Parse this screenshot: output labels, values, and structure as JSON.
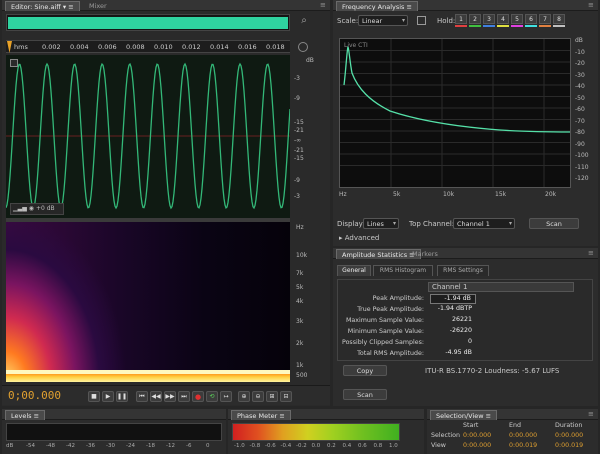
{
  "editor": {
    "tab_label": "Editor: Sine.aiff",
    "mixer_tab": "Mixer",
    "ruler_ticks": [
      "hms",
      "0.002",
      "0.004",
      "0.006",
      "0.008",
      "0.010",
      "0.012",
      "0.014",
      "0.016",
      "0.018"
    ],
    "db_scale": [
      "dB",
      "-3",
      "-9",
      "-15",
      "-21",
      "-∞",
      "-21",
      "-15",
      "-9",
      "-3"
    ],
    "hud_value": "+0 dB",
    "freq_scale": [
      "Hz",
      "10k",
      "7k",
      "5k",
      "4k",
      "3k",
      "2k",
      "1k",
      "500"
    ],
    "time_display": "0;00.000"
  },
  "frequency": {
    "tab_label": "Frequency Analysis",
    "scale_label": "Scale:",
    "scale_value": "Linear",
    "hold_label": "Hold:",
    "hold_buttons": [
      "1",
      "2",
      "3",
      "4",
      "5",
      "6",
      "7",
      "8"
    ],
    "hold_colors": [
      "#e04040",
      "#40c040",
      "#4080e0",
      "#e0e040",
      "#e040e0",
      "#40e0e0",
      "#e08040",
      "#c0c0c0"
    ],
    "live_label": "Live CTI",
    "x_ticks": [
      "Hz",
      "5k",
      "10k",
      "15k",
      "20k"
    ],
    "y_ticks": [
      "dB",
      "-10",
      "-20",
      "-30",
      "-40",
      "-50",
      "-60",
      "-70",
      "-80",
      "-90",
      "-100",
      "-110",
      "-120"
    ],
    "display_label": "Display:",
    "display_value": "Lines",
    "top_channel_label": "Top Channel:",
    "top_channel_value": "Channel 1",
    "scan_label": "Scan",
    "advanced_label": "Advanced"
  },
  "amplitude": {
    "tab_label": "Amplitude Statistics",
    "markers_tab": "Markers",
    "subtabs": [
      "General",
      "RMS Histogram",
      "RMS Settings"
    ],
    "channel_header": "Channel 1",
    "rows": [
      {
        "label": "Peak Amplitude:",
        "value": "-1.94 dB"
      },
      {
        "label": "True Peak Amplitude:",
        "value": "-1.94 dBTP"
      },
      {
        "label": "Maximum Sample Value:",
        "value": "26221"
      },
      {
        "label": "Minimum Sample Value:",
        "value": "-26220"
      },
      {
        "label": "Possibly Clipped Samples:",
        "value": "0"
      },
      {
        "label": "Total RMS Amplitude:",
        "value": "-4.95 dB"
      }
    ],
    "copy_label": "Copy",
    "loudness_text": "ITU-R BS.1770-2 Loudness: -5.67 LUFS",
    "scan_label": "Scan"
  },
  "levels": {
    "tab_label": "Levels",
    "ticks": [
      "dB",
      "-54",
      "-48",
      "-42",
      "-36",
      "-30",
      "-24",
      "-18",
      "-12",
      "-6",
      "0"
    ]
  },
  "phase": {
    "tab_label": "Phase Meter",
    "ticks": [
      "-1.0",
      "-0.8",
      "-0.6",
      "-0.4",
      "-0.2",
      "0.0",
      "0.2",
      "0.4",
      "0.6",
      "0.8",
      "1.0"
    ]
  },
  "selection": {
    "tab_label": "Selection/View",
    "headers": [
      "Start",
      "End",
      "Duration"
    ],
    "rows": [
      {
        "label": "Selection",
        "start": "0:00.000",
        "end": "0:00.000",
        "duration": "0:00.000"
      },
      {
        "label": "View",
        "start": "0:00.000",
        "end": "0:00.019",
        "duration": "0:00.019"
      }
    ]
  }
}
